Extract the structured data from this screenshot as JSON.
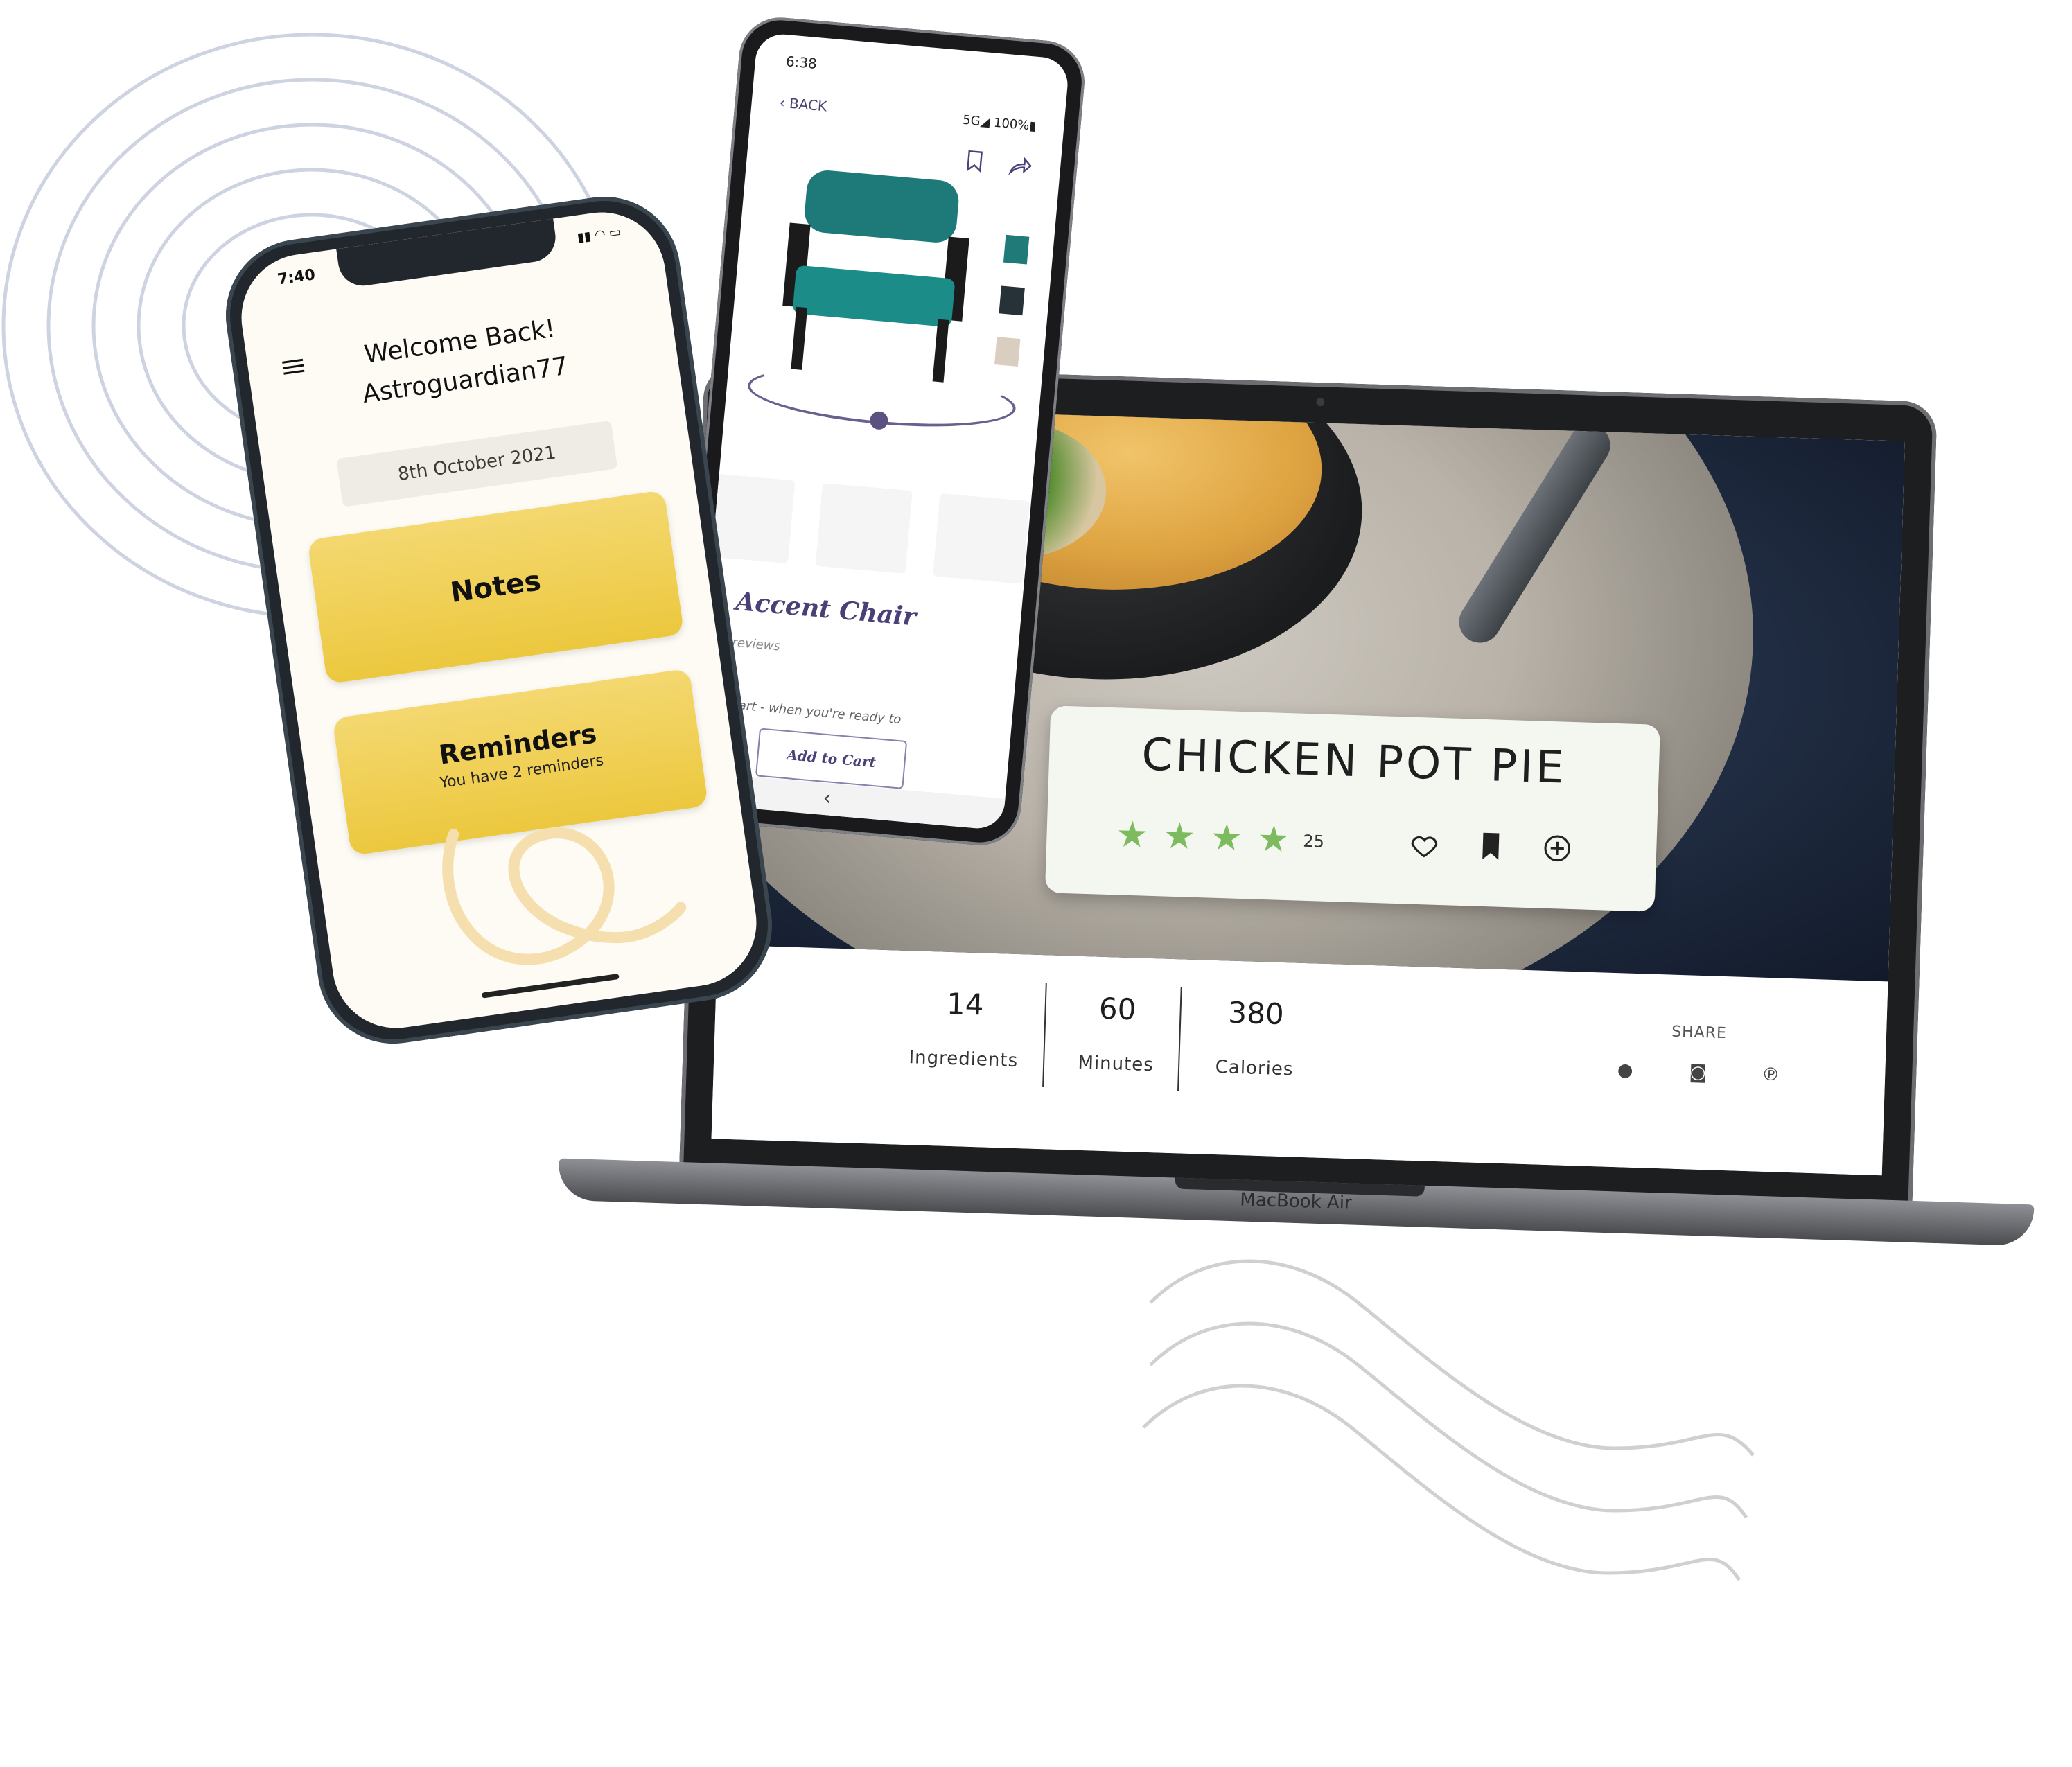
{
  "laptop": {
    "brand": "MacBook Air",
    "recipe": {
      "title": "CHICKEN POT PIE",
      "rating": 4,
      "rating_count": "25",
      "star_color": "#7dbb5e"
    },
    "stats": [
      {
        "value": "14",
        "label": "Ingredients"
      },
      {
        "value": "60",
        "label": "Minutes"
      },
      {
        "value": "380",
        "label": "Calories"
      }
    ],
    "share": {
      "label": "SHARE",
      "icons": [
        "facebook-icon",
        "instagram-icon",
        "pinterest-icon"
      ]
    }
  },
  "android": {
    "time": "6:38",
    "back_label": "BACK",
    "status_right": "5G◢ 100%▮",
    "product_title": "Accent Chair",
    "reviews_text": "reviews",
    "description_fragment": "n art - when you're ready to",
    "add_to_cart": "Add to Cart",
    "swatch_colors": [
      "#1f7a78",
      "#263238",
      "#d9cec0"
    ],
    "accent_color": "#4b3f78"
  },
  "iphone": {
    "time": "7:40",
    "welcome_line1": "Welcome Back!",
    "welcome_line2": "Astroguardian77",
    "date": "8th October 2021",
    "notes_label": "Notes",
    "reminders_label": "Reminders",
    "reminders_sub": "You have 2 reminders",
    "card_color": "#ecc83e"
  }
}
